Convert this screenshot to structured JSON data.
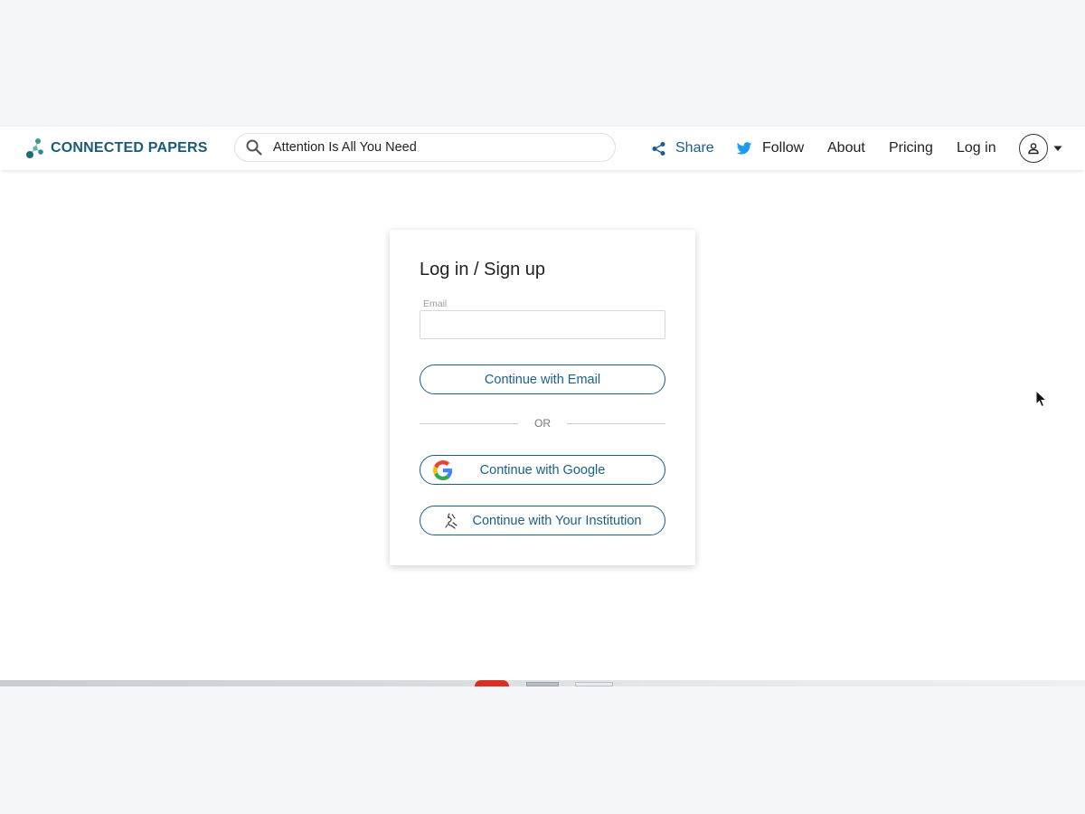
{
  "brand": {
    "name": "CONNECTED PAPERS",
    "logo_icon": "connected-dots-logo"
  },
  "search": {
    "value": "Attention Is All You Need",
    "icon": "search-icon"
  },
  "nav": {
    "share_label": "Share",
    "follow_label": "Follow",
    "about_label": "About",
    "pricing_label": "Pricing",
    "login_label": "Log in",
    "share_icon": "share-icon",
    "follow_icon": "twitter-bird-icon",
    "account_icon": "user-icon",
    "account_caret": "caret-down-icon"
  },
  "login": {
    "title": "Log in / Sign up",
    "email_label": "Email",
    "email_value": "",
    "continue_email": "Continue with Email",
    "or_text": "OR",
    "continue_google": "Continue with Google",
    "continue_institution": "Continue with Your Institution"
  },
  "colors": {
    "brand_blue": "#1a5a7a",
    "accent_blue": "#1a5f8c",
    "page_background": "#ffffff",
    "outer_background": "#f5f7fa",
    "twitter_blue": "#1d9bf0"
  }
}
